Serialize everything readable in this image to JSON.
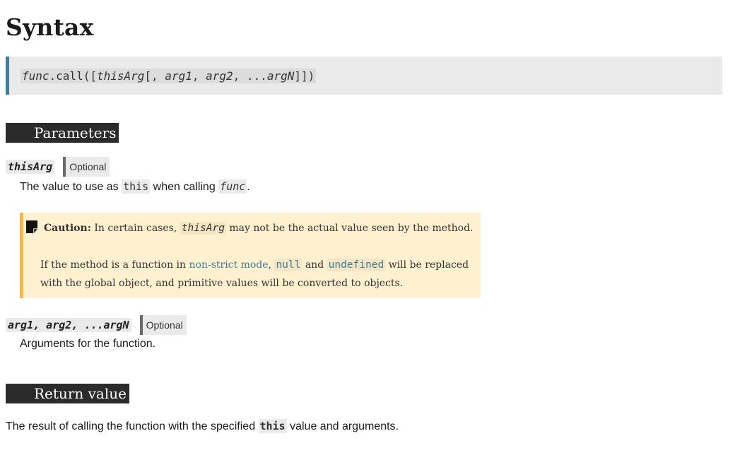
{
  "page_title": "Syntax",
  "syntax": {
    "func": "func",
    "call_open": ".call([",
    "this_arg": "thisArg",
    "sep1": "[, ",
    "arg1": "arg1",
    "comma1": ", ",
    "arg2": "arg2",
    "comma2": ", ...",
    "argN": "argN",
    "close": "]])"
  },
  "parameters": {
    "heading": "Parameters",
    "this_arg": {
      "name": "thisArg",
      "badge": "Optional",
      "desc_pre": "The value to use as ",
      "desc_code1": "this",
      "desc_mid": " when calling ",
      "desc_code2": "func",
      "desc_post": "."
    },
    "caution": {
      "label": "Caution:",
      "line1_pre": " In certain cases, ",
      "line1_code": "thisArg",
      "line1_post": " may not be the actual value seen by the method.",
      "para_pre": "If the method is a function in ",
      "para_link": "non-strict mode",
      "para_comma": ", ",
      "para_code1": "null",
      "para_and": " and ",
      "para_code2": "undefined",
      "para_post": " will be replaced with the global object, and primitive values will be converted to objects."
    },
    "args": {
      "name": "arg1, arg2, ...argN",
      "badge": "Optional",
      "desc": "Arguments for the function."
    }
  },
  "return_value": {
    "heading": "Return value",
    "text_pre": "The result of calling the function with the specified ",
    "text_code": "this",
    "text_post": " value and arguments."
  }
}
